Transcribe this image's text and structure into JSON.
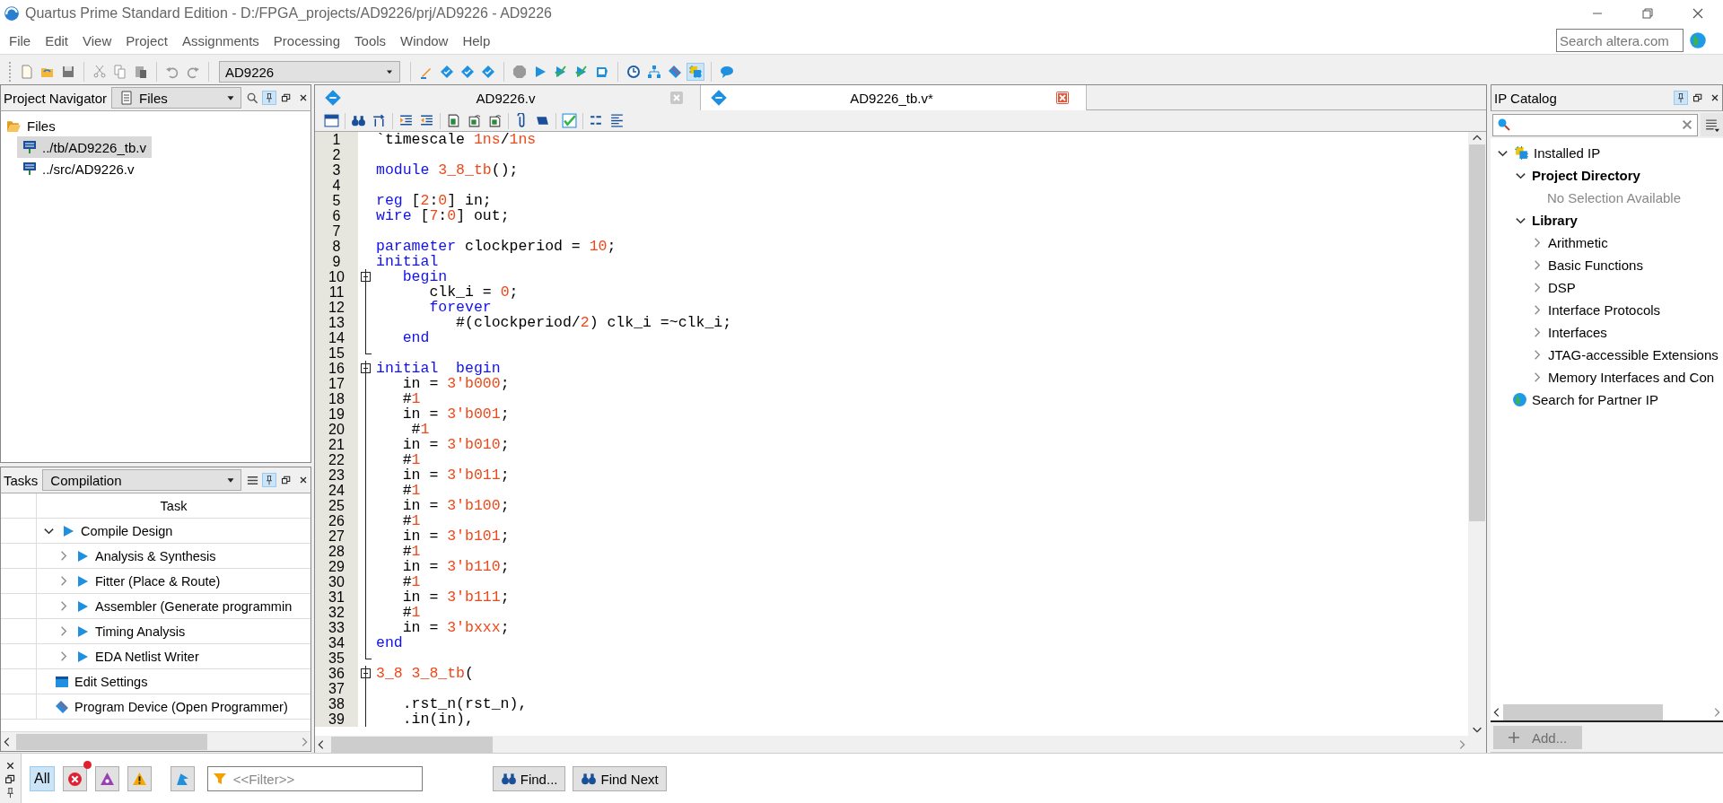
{
  "window": {
    "title": "Quartus Prime Standard Edition - D:/FPGA_projects/AD9226/prj/AD9226 - AD9226"
  },
  "menu": [
    "File",
    "Edit",
    "View",
    "Project",
    "Assignments",
    "Processing",
    "Tools",
    "Window",
    "Help"
  ],
  "search": {
    "placeholder": "Search altera.com"
  },
  "toolbar": {
    "revision": "AD9226",
    "ip_catalog_on": true
  },
  "navigator": {
    "title": "Project Navigator",
    "view": "Files",
    "pinned": true,
    "tree": [
      {
        "label": "Files",
        "expanded": true,
        "selected": false,
        "children": [
          {
            "label": "../tb/AD9226_tb.v",
            "selected": true
          },
          {
            "label": "../src/AD9226.v",
            "selected": false
          }
        ]
      }
    ]
  },
  "tasks": {
    "title": "Tasks",
    "flow": "Compilation",
    "pinned": true,
    "column": "Task",
    "rows": [
      {
        "kind": "flow",
        "label": "Compile Design",
        "expanded": true,
        "children": [
          {
            "kind": "flow",
            "label": "Analysis & Synthesis",
            "expanded": false
          },
          {
            "kind": "flow",
            "label": "Fitter (Place & Route)",
            "expanded": false
          },
          {
            "kind": "flow",
            "label": "Assembler (Generate programmin",
            "expanded": false
          },
          {
            "kind": "flow",
            "label": "Timing Analysis",
            "expanded": false
          },
          {
            "kind": "flow",
            "label": "EDA Netlist Writer",
            "expanded": false
          }
        ]
      },
      {
        "kind": "settings",
        "label": "Edit Settings"
      },
      {
        "kind": "program",
        "label": "Program Device (Open Programmer)"
      }
    ]
  },
  "editor": {
    "tabs": [
      {
        "label": "AD9226.v",
        "selected": false
      },
      {
        "label": "AD9226_tb.v*",
        "selected": true
      }
    ],
    "lines": [
      {
        "n": "1",
        "kind": "plain",
        "segs": [
          {
            "t": "`timescale ",
            "color": "#000000"
          },
          {
            "t": "1ns",
            "color": "#f04818"
          },
          {
            "t": "/",
            "color": "#000000"
          },
          {
            "t": "1ns",
            "color": "#f04818"
          }
        ]
      },
      {
        "n": "2",
        "kind": "plain"
      },
      {
        "n": "3",
        "kind": "plain",
        "segs": [
          {
            "t": "module ",
            "color": "#1010f0"
          },
          {
            "t": "3_8_tb",
            "color": "#f04818"
          },
          {
            "t": "();",
            "color": "#000000"
          }
        ]
      },
      {
        "n": "4",
        "kind": "plain"
      },
      {
        "n": "5",
        "kind": "plain",
        "segs": [
          {
            "t": "reg ",
            "color": "#1010f0"
          },
          {
            "t": "[",
            "color": "#000000"
          },
          {
            "t": "2",
            "color": "#f04818"
          },
          {
            "t": ":",
            "color": "#000000"
          },
          {
            "t": "0",
            "color": "#f04818"
          },
          {
            "t": "] in;",
            "color": "#000000"
          }
        ]
      },
      {
        "n": "6",
        "kind": "plain",
        "segs": [
          {
            "t": "wire ",
            "color": "#1010f0"
          },
          {
            "t": "[",
            "color": "#000000"
          },
          {
            "t": "7",
            "color": "#f04818"
          },
          {
            "t": ":",
            "color": "#000000"
          },
          {
            "t": "0",
            "color": "#f04818"
          },
          {
            "t": "] out;",
            "color": "#000000"
          }
        ]
      },
      {
        "n": "7",
        "kind": "plain"
      },
      {
        "n": "8",
        "kind": "plain",
        "segs": [
          {
            "t": "parameter",
            "color": "#1010f0"
          },
          {
            "t": " clockperiod = ",
            "color": "#000000"
          },
          {
            "t": "10",
            "color": "#f04818"
          },
          {
            "t": ";",
            "color": "#000000"
          }
        ]
      },
      {
        "n": "9",
        "kind": "plain",
        "segs": [
          {
            "t": "initial",
            "color": "#1010f0"
          }
        ]
      },
      {
        "n": "10",
        "kind": "start",
        "segs": [
          {
            "t": "   begin",
            "color": "#1010f0"
          }
        ]
      },
      {
        "n": "11",
        "kind": "mid",
        "segs": [
          {
            "t": "      clk_i = ",
            "color": "#000000"
          },
          {
            "t": "0",
            "color": "#f04818"
          },
          {
            "t": ";",
            "color": "#000000"
          }
        ]
      },
      {
        "n": "12",
        "kind": "mid",
        "segs": [
          {
            "t": "      forever",
            "color": "#1010f0"
          }
        ]
      },
      {
        "n": "13",
        "kind": "mid",
        "segs": [
          {
            "t": "         #(clockperiod/",
            "color": "#000000"
          },
          {
            "t": "2",
            "color": "#f04818"
          },
          {
            "t": ") clk_i =~clk_i;",
            "color": "#000000"
          }
        ]
      },
      {
        "n": "14",
        "kind": "mid",
        "segs": [
          {
            "t": "   end",
            "color": "#1010f0"
          }
        ]
      },
      {
        "n": "15",
        "kind": "end"
      },
      {
        "n": "16",
        "kind": "start",
        "segs": [
          {
            "t": "initial  begin",
            "color": "#1010f0"
          }
        ]
      },
      {
        "n": "17",
        "kind": "mid",
        "segs": [
          {
            "t": "   in = ",
            "color": "#000000"
          },
          {
            "t": "3'b000",
            "color": "#f04818"
          },
          {
            "t": ";",
            "color": "#000000"
          }
        ]
      },
      {
        "n": "18",
        "kind": "mid",
        "segs": [
          {
            "t": "   #",
            "color": "#000000"
          },
          {
            "t": "1",
            "color": "#f04818"
          }
        ]
      },
      {
        "n": "19",
        "kind": "mid",
        "segs": [
          {
            "t": "   in = ",
            "color": "#000000"
          },
          {
            "t": "3'b001",
            "color": "#f04818"
          },
          {
            "t": ";",
            "color": "#000000"
          }
        ]
      },
      {
        "n": "20",
        "kind": "mid",
        "segs": [
          {
            "t": "    #",
            "color": "#000000"
          },
          {
            "t": "1",
            "color": "#f04818"
          }
        ]
      },
      {
        "n": "21",
        "kind": "mid",
        "segs": [
          {
            "t": "   in = ",
            "color": "#000000"
          },
          {
            "t": "3'b010",
            "color": "#f04818"
          },
          {
            "t": ";",
            "color": "#000000"
          }
        ]
      },
      {
        "n": "22",
        "kind": "mid",
        "segs": [
          {
            "t": "   #",
            "color": "#000000"
          },
          {
            "t": "1",
            "color": "#f04818"
          }
        ]
      },
      {
        "n": "23",
        "kind": "mid",
        "segs": [
          {
            "t": "   in = ",
            "color": "#000000"
          },
          {
            "t": "3'b011",
            "color": "#f04818"
          },
          {
            "t": ";",
            "color": "#000000"
          }
        ]
      },
      {
        "n": "24",
        "kind": "mid",
        "segs": [
          {
            "t": "   #",
            "color": "#000000"
          },
          {
            "t": "1",
            "color": "#f04818"
          }
        ]
      },
      {
        "n": "25",
        "kind": "mid",
        "segs": [
          {
            "t": "   in = ",
            "color": "#000000"
          },
          {
            "t": "3'b100",
            "color": "#f04818"
          },
          {
            "t": ";",
            "color": "#000000"
          }
        ]
      },
      {
        "n": "26",
        "kind": "mid",
        "segs": [
          {
            "t": "   #",
            "color": "#000000"
          },
          {
            "t": "1",
            "color": "#f04818"
          }
        ]
      },
      {
        "n": "27",
        "kind": "mid",
        "segs": [
          {
            "t": "   in = ",
            "color": "#000000"
          },
          {
            "t": "3'b101",
            "color": "#f04818"
          },
          {
            "t": ";",
            "color": "#000000"
          }
        ]
      },
      {
        "n": "28",
        "kind": "mid",
        "segs": [
          {
            "t": "   #",
            "color": "#000000"
          },
          {
            "t": "1",
            "color": "#f04818"
          }
        ]
      },
      {
        "n": "29",
        "kind": "mid",
        "segs": [
          {
            "t": "   in = ",
            "color": "#000000"
          },
          {
            "t": "3'b110",
            "color": "#f04818"
          },
          {
            "t": ";",
            "color": "#000000"
          }
        ]
      },
      {
        "n": "30",
        "kind": "mid",
        "segs": [
          {
            "t": "   #",
            "color": "#000000"
          },
          {
            "t": "1",
            "color": "#f04818"
          }
        ]
      },
      {
        "n": "31",
        "kind": "mid",
        "segs": [
          {
            "t": "   in = ",
            "color": "#000000"
          },
          {
            "t": "3'b111",
            "color": "#f04818"
          },
          {
            "t": ";",
            "color": "#000000"
          }
        ]
      },
      {
        "n": "32",
        "kind": "mid",
        "segs": [
          {
            "t": "   #",
            "color": "#000000"
          },
          {
            "t": "1",
            "color": "#f04818"
          }
        ]
      },
      {
        "n": "33",
        "kind": "mid",
        "segs": [
          {
            "t": "   in = ",
            "color": "#000000"
          },
          {
            "t": "3'bxxx",
            "color": "#f04818"
          },
          {
            "t": ";",
            "color": "#000000"
          }
        ]
      },
      {
        "n": "34",
        "kind": "mid",
        "segs": [
          {
            "t": "end",
            "color": "#1010f0"
          }
        ]
      },
      {
        "n": "35",
        "kind": "end"
      },
      {
        "n": "36",
        "kind": "start",
        "segs": [
          {
            "t": "3_8 3_8_tb",
            "color": "#f04818"
          },
          {
            "t": "(",
            "color": "#000000"
          }
        ]
      },
      {
        "n": "37",
        "kind": "mid"
      },
      {
        "n": "38",
        "kind": "mid",
        "segs": [
          {
            "t": "   .rst_n(rst_n),",
            "color": "#000000"
          }
        ]
      },
      {
        "n": "39",
        "kind": "mid",
        "segs": [
          {
            "t": "   .in(in),",
            "color": "#000000"
          }
        ]
      }
    ]
  },
  "ip_catalog": {
    "title": "IP Catalog",
    "pinned": true,
    "tree": [
      {
        "kind": "root",
        "label": "Installed IP",
        "expanded": true,
        "children": [
          {
            "kind": "category",
            "label": "Project Directory",
            "expanded": true,
            "children": [
              {
                "kind": "note",
                "label": "No Selection Available"
              }
            ]
          },
          {
            "kind": "category",
            "label": "Library",
            "expanded": true,
            "children": [
              {
                "kind": "item",
                "label": "Arithmetic",
                "expanded": false
              },
              {
                "kind": "item",
                "label": "Basic Functions",
                "expanded": false
              },
              {
                "kind": "item",
                "label": "DSP",
                "expanded": false
              },
              {
                "kind": "item",
                "label": "Interface Protocols",
                "expanded": false
              },
              {
                "kind": "item",
                "label": "Interfaces",
                "expanded": false
              },
              {
                "kind": "item",
                "label": "JTAG-accessible Extensions",
                "expanded": false
              },
              {
                "kind": "item",
                "label": "Memory Interfaces and Con",
                "expanded": false
              }
            ]
          }
        ]
      },
      {
        "kind": "link",
        "label": "Search for Partner IP"
      }
    ],
    "add_button": {
      "label": "Add...",
      "disabled": true
    }
  },
  "messages": {
    "filters": [
      {
        "kind": "all",
        "label": "All",
        "selected": true,
        "alert": false
      },
      {
        "kind": "error",
        "selected": false,
        "alert": true
      },
      {
        "kind": "critical",
        "selected": false,
        "alert": false
      },
      {
        "kind": "warning",
        "selected": false,
        "alert": false
      },
      {
        "kind": "flag",
        "selected": false,
        "alert": false
      }
    ],
    "filter_placeholder": "<<Filter>>",
    "buttons": [
      "Find...",
      "Find Next"
    ]
  }
}
